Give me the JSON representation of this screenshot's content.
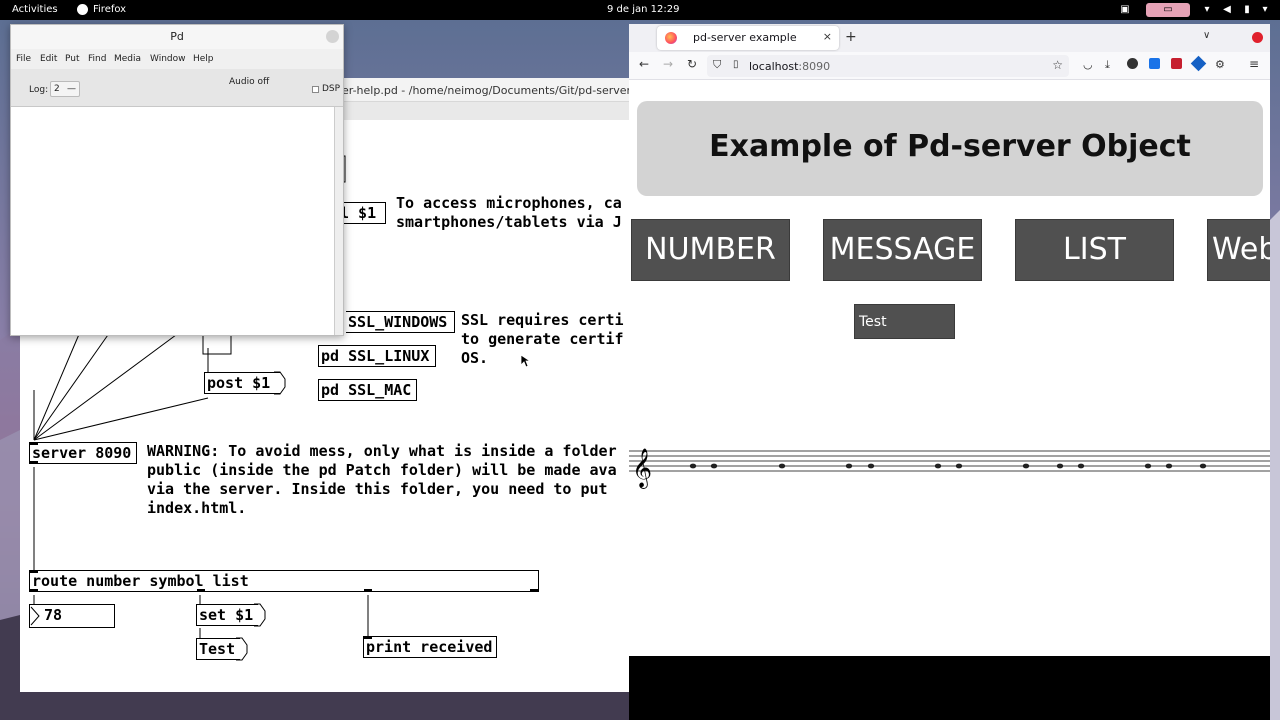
{
  "topbar": {
    "activities": "Activities",
    "app_name": "Firefox",
    "clock": "9 de jan  12:29"
  },
  "pd_main": {
    "title": "Pd",
    "menu": [
      "File",
      "Edit",
      "Put",
      "Find",
      "Media",
      "Window",
      "Help"
    ],
    "audio_status": "Audio off",
    "log_label": "Log:",
    "log_value": "2",
    "dsp_label": "DSP"
  },
  "patch_window": {
    "title": "er-help.pd  - /home/neimog/Documents/Git/pd-server",
    "objects": {
      "top_message": "l $1",
      "ssl_windows": "SSL_WINDOWS",
      "ssl_linux": "pd SSL_LINUX",
      "ssl_mac": "pd SSL_MAC",
      "post": "post $1",
      "server": "server 8090",
      "route": "route number symbol list",
      "number_box": "78",
      "set_msg": "set $1",
      "test_msg": "Test",
      "print": "print received"
    },
    "comments": {
      "microphones": "To access microphones, ca\nsmartphones/tablets via J",
      "ssl": "SSL requires certi\nto generate certif\nOS.",
      "warning": "WARNING: To avoid mess, only what is inside a folder\npublic (inside the pd Patch folder) will be made ava\nvia the server. Inside this folder, you need to put \nindex.html."
    }
  },
  "firefox": {
    "tab_title": "pd-server example",
    "url_host": "localhost",
    "url_port": ":8090",
    "page": {
      "heading": "Example of Pd-server Object",
      "buttons": [
        "NUMBER",
        "MESSAGE",
        "LIST",
        "Web"
      ],
      "test_value": "Test"
    }
  }
}
